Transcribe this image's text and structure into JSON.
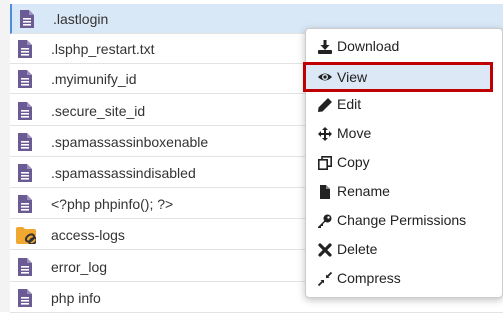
{
  "files": [
    {
      "name": ".lastlogin",
      "type": "file",
      "selected": true
    },
    {
      "name": ".lsphp_restart.txt",
      "type": "file"
    },
    {
      "name": ".myimunify_id",
      "type": "file"
    },
    {
      "name": ".secure_site_id",
      "type": "file"
    },
    {
      "name": ".spamassassinboxenable",
      "type": "file"
    },
    {
      "name": ".spamassassindisabled",
      "type": "file"
    },
    {
      "name": "<?php phpinfo(); ?>",
      "type": "file"
    },
    {
      "name": "access-logs",
      "type": "folder-link"
    },
    {
      "name": "error_log",
      "type": "file"
    },
    {
      "name": "php info",
      "type": "file"
    }
  ],
  "context_menu": {
    "items": [
      {
        "label": "Download",
        "icon": "download-icon"
      },
      {
        "label": "View",
        "icon": "eye-icon",
        "highlighted": true
      },
      {
        "label": "Edit",
        "icon": "pencil-icon"
      },
      {
        "label": "Move",
        "icon": "move-arrows-icon"
      },
      {
        "label": "Copy",
        "icon": "copy-icon"
      },
      {
        "label": "Rename",
        "icon": "file-icon"
      },
      {
        "label": "Change Permissions",
        "icon": "key-icon"
      },
      {
        "label": "Delete",
        "icon": "x-icon"
      },
      {
        "label": "Compress",
        "icon": "compress-icon"
      }
    ]
  },
  "colors": {
    "file_icon": "#6b5b95",
    "folder_icon": "#f0a830",
    "selected_row": "#d9e8f7",
    "highlight_border": "#c00000"
  }
}
